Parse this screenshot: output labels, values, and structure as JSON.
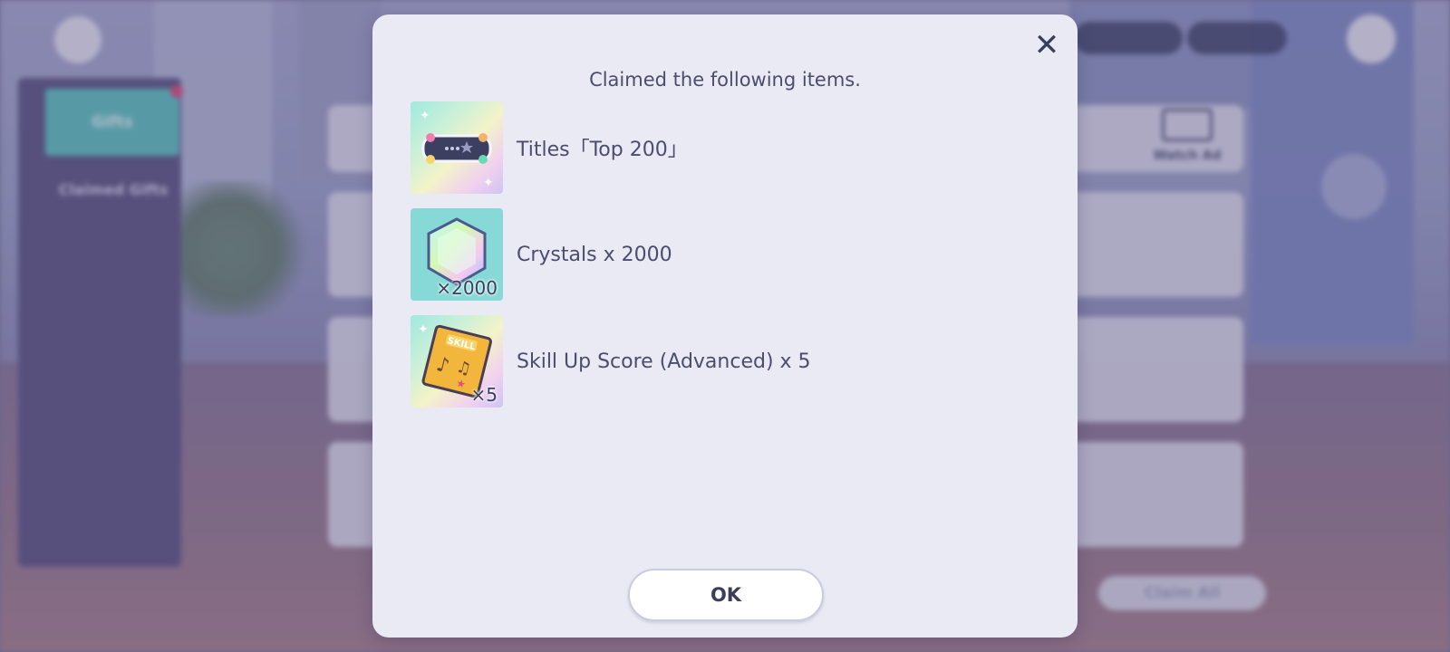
{
  "background": {
    "tabs": [
      "Gifts",
      "Claimed Gifts"
    ],
    "watch_ad_label": "Watch Ad",
    "claim_all_label": "Claim All"
  },
  "modal": {
    "title": "Claimed the following items.",
    "close_icon": "close-icon",
    "ok_label": "OK",
    "items": [
      {
        "label": "Titles「Top 200」",
        "icon": "title-badge-icon",
        "quantity": ""
      },
      {
        "label": "Crystals x 2000",
        "icon": "crystal-icon",
        "quantity": "×2000"
      },
      {
        "label": "Skill Up Score (Advanced) x 5",
        "icon": "skill-score-icon",
        "quantity": "×5"
      }
    ]
  },
  "colors": {
    "modal_bg": "#e9eaf3",
    "text": "#4a4d6e",
    "accent_teal": "#5fc8c2",
    "badge_red": "#e0507a"
  }
}
